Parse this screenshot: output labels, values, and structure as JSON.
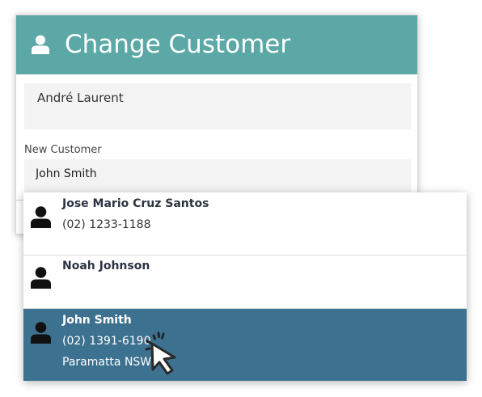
{
  "dialog": {
    "title": "Change Customer",
    "header_icon": "person-icon",
    "header_color": "#5ba8a6",
    "current_customer": "André Laurent",
    "new_customer_label": "New Customer",
    "new_customer_value": "John Smith"
  },
  "dropdown": {
    "selected_color": "#3d7190",
    "results": [
      {
        "name": "Jose Mario Cruz Santos",
        "phone": "(02) 1233-1188"
      },
      {
        "name": "Noah Johnson"
      },
      {
        "name": "John Smith",
        "phone": "(02) 1391-6190",
        "city": "Paramatta NSW",
        "selected": true
      }
    ]
  },
  "cursor": {
    "icon": "click-pointer-icon"
  }
}
